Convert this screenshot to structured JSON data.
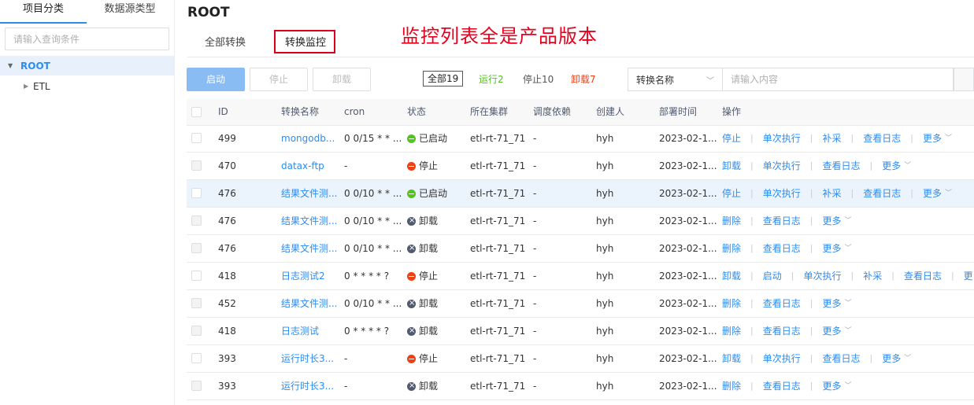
{
  "sidebar": {
    "tabs": [
      "项目分类",
      "数据源类型"
    ],
    "search_placeholder": "请输入查询条件",
    "tree": {
      "root": "ROOT",
      "child": "ETL"
    }
  },
  "header": {
    "title": "ROOT"
  },
  "tabs": [
    "全部转换",
    "转换监控"
  ],
  "annotation": "监控列表全是产品版本",
  "toolbar": {
    "start": "启动",
    "stop": "停止",
    "unload": "卸载",
    "filters": {
      "all": "全部19",
      "running": "运行2",
      "stopped": "停止10",
      "unloaded": "卸载7"
    },
    "select_value": "转换名称",
    "search_placeholder": "请输入内容"
  },
  "colors": {
    "accent": "#2d8cf0",
    "running": "#52c41a",
    "stopped": "#ed4014",
    "annotation": "#e8001c"
  },
  "table": {
    "headers": [
      "ID",
      "转换名称",
      "cron",
      "状态",
      "所在集群",
      "调度依赖",
      "创建人",
      "部署时间",
      "操作"
    ],
    "rows": [
      {
        "id": "499",
        "name": "mongodb...",
        "cron": "0 0/15 * * ...",
        "status": "已启动",
        "cluster": "etl-rt-71_71",
        "dep": "-",
        "creator": "hyh",
        "time": "2023-02-1...",
        "ops": [
          "停止",
          "单次执行",
          "补采",
          "查看日志",
          "更多"
        ]
      },
      {
        "id": "470",
        "name": "datax-ftp",
        "cron": "-",
        "status": "停止",
        "cluster": "etl-rt-71_71",
        "dep": "-",
        "creator": "hyh",
        "time": "2023-02-1...",
        "ops": [
          "卸载",
          "单次执行",
          "查看日志",
          "更多"
        ]
      },
      {
        "id": "476",
        "name": "结果文件测...",
        "cron": "0 0/10 * * ...",
        "status": "已启动",
        "cluster": "etl-rt-71_71",
        "dep": "-",
        "creator": "hyh",
        "time": "2023-02-1...",
        "ops": [
          "停止",
          "单次执行",
          "补采",
          "查看日志",
          "更多"
        ]
      },
      {
        "id": "476",
        "name": "结果文件测...",
        "cron": "0 0/10 * * ...",
        "status": "卸载",
        "cluster": "etl-rt-71_71",
        "dep": "-",
        "creator": "hyh",
        "time": "2023-02-1...",
        "ops": [
          "删除",
          "查看日志",
          "更多"
        ]
      },
      {
        "id": "476",
        "name": "结果文件测...",
        "cron": "0 0/10 * * ...",
        "status": "卸载",
        "cluster": "etl-rt-71_71",
        "dep": "-",
        "creator": "hyh",
        "time": "2023-02-1...",
        "ops": [
          "删除",
          "查看日志",
          "更多"
        ]
      },
      {
        "id": "418",
        "name": "日志测试2",
        "cron": "0 * * * * ?",
        "status": "停止",
        "cluster": "etl-rt-71_71",
        "dep": "-",
        "creator": "hyh",
        "time": "2023-02-1...",
        "ops": [
          "卸载",
          "启动",
          "单次执行",
          "补采",
          "查看日志",
          "更"
        ]
      },
      {
        "id": "452",
        "name": "结果文件测...",
        "cron": "0 0/10 * * ...",
        "status": "卸载",
        "cluster": "etl-rt-71_71",
        "dep": "-",
        "creator": "hyh",
        "time": "2023-02-1...",
        "ops": [
          "删除",
          "查看日志",
          "更多"
        ]
      },
      {
        "id": "418",
        "name": "日志测试",
        "cron": "0 * * * * ?",
        "status": "卸载",
        "cluster": "etl-rt-71_71",
        "dep": "-",
        "creator": "hyh",
        "time": "2023-02-1...",
        "ops": [
          "删除",
          "查看日志",
          "更多"
        ]
      },
      {
        "id": "393",
        "name": "运行时长3...",
        "cron": "-",
        "status": "停止",
        "cluster": "etl-rt-71_71",
        "dep": "-",
        "creator": "hyh",
        "time": "2023-02-1...",
        "ops": [
          "卸载",
          "单次执行",
          "查看日志",
          "更多"
        ]
      },
      {
        "id": "393",
        "name": "运行时长3...",
        "cron": "-",
        "status": "卸载",
        "cluster": "etl-rt-71_71",
        "dep": "-",
        "creator": "hyh",
        "time": "2023-02-1...",
        "ops": [
          "删除",
          "查看日志",
          "更多"
        ]
      }
    ]
  }
}
